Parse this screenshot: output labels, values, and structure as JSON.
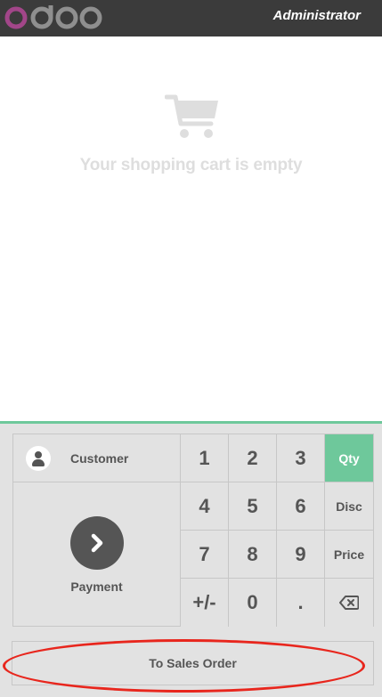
{
  "app": {
    "logo_text": "odoo",
    "user_name": "Administrator"
  },
  "cart": {
    "empty_message": "Your shopping cart is empty",
    "icon": "shopping-cart-icon"
  },
  "actions": {
    "customer_label": "Customer",
    "payment_label": "Payment"
  },
  "numpad": {
    "keys": [
      {
        "label": "1",
        "name": "numpad-key-1"
      },
      {
        "label": "2",
        "name": "numpad-key-2"
      },
      {
        "label": "3",
        "name": "numpad-key-3"
      },
      {
        "label": "Qty",
        "name": "mode-qty-button",
        "mode": true,
        "selected": true
      },
      {
        "label": "4",
        "name": "numpad-key-4"
      },
      {
        "label": "5",
        "name": "numpad-key-5"
      },
      {
        "label": "6",
        "name": "numpad-key-6"
      },
      {
        "label": "Disc",
        "name": "mode-disc-button",
        "mode": true
      },
      {
        "label": "7",
        "name": "numpad-key-7"
      },
      {
        "label": "8",
        "name": "numpad-key-8"
      },
      {
        "label": "9",
        "name": "numpad-key-9"
      },
      {
        "label": "Price",
        "name": "mode-price-button",
        "mode": true
      },
      {
        "label": "+/-",
        "name": "numpad-key-plus-minus"
      },
      {
        "label": "0",
        "name": "numpad-key-0"
      },
      {
        "label": ".",
        "name": "numpad-key-decimal"
      },
      {
        "label": "",
        "name": "backspace-button",
        "icon": "backspace-icon"
      }
    ]
  },
  "sales_order_label": "To Sales Order",
  "colors": {
    "topbar": "#3b3b3b",
    "accent": "#6ec89b",
    "logo_o": "#a24689",
    "annotation": "#e8261d"
  }
}
